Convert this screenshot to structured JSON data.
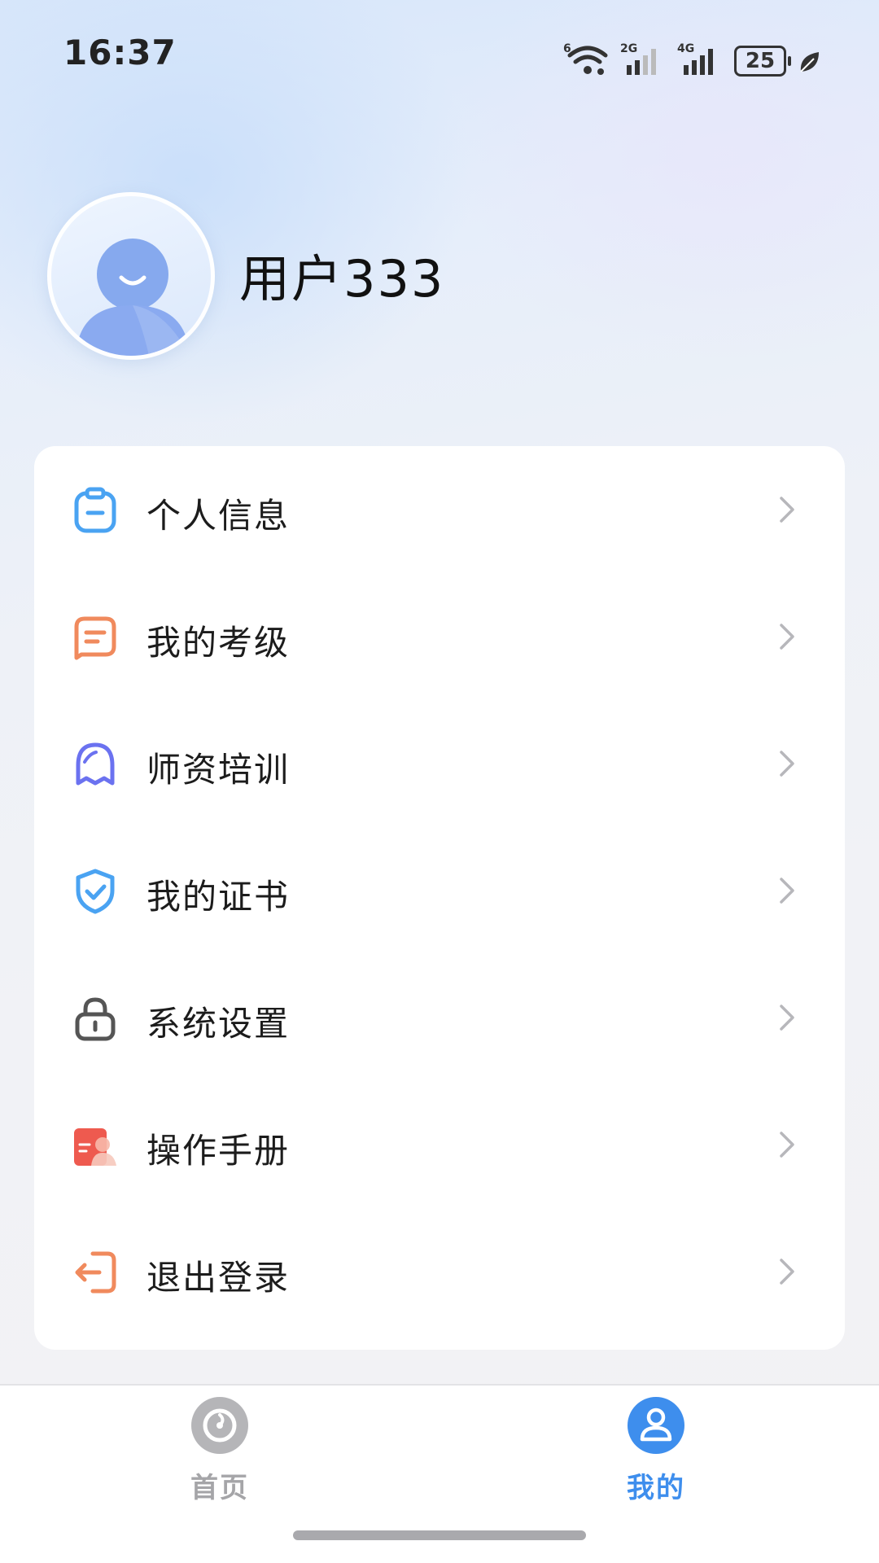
{
  "status_bar": {
    "time": "16:37",
    "battery": "25",
    "icons": [
      "wifi-icon",
      "signal-2g-icon",
      "signal-4g-icon",
      "battery-icon",
      "leaf-icon"
    ]
  },
  "profile": {
    "username": "用户333",
    "avatar_icon": "user-avatar-icon"
  },
  "menu": {
    "items": [
      {
        "label": "个人信息",
        "icon": "clipboard-icon",
        "color": "#4aa3f2"
      },
      {
        "label": "我的考级",
        "icon": "message-doc-icon",
        "color": "#f08a5d"
      },
      {
        "label": "师资培训",
        "icon": "ghost-icon",
        "color": "#6b72f0"
      },
      {
        "label": "我的证书",
        "icon": "shield-check-icon",
        "color": "#4aa3f2"
      },
      {
        "label": "系统设置",
        "icon": "lock-icon",
        "color": "#555555"
      },
      {
        "label": "操作手册",
        "icon": "manual-book-icon",
        "color": "#ee5a4f"
      },
      {
        "label": "退出登录",
        "icon": "logout-icon",
        "color": "#f08a5d"
      }
    ]
  },
  "tab_bar": {
    "tabs": [
      {
        "label": "首页",
        "icon": "home-tab-icon",
        "active": false,
        "color": "#a5a5a8"
      },
      {
        "label": "我的",
        "icon": "profile-tab-icon",
        "active": true,
        "color": "#3e8eed"
      }
    ]
  },
  "colors": {
    "accent": "#3e8eed",
    "card_background": "#ffffff",
    "text": "#1c1c1c"
  }
}
